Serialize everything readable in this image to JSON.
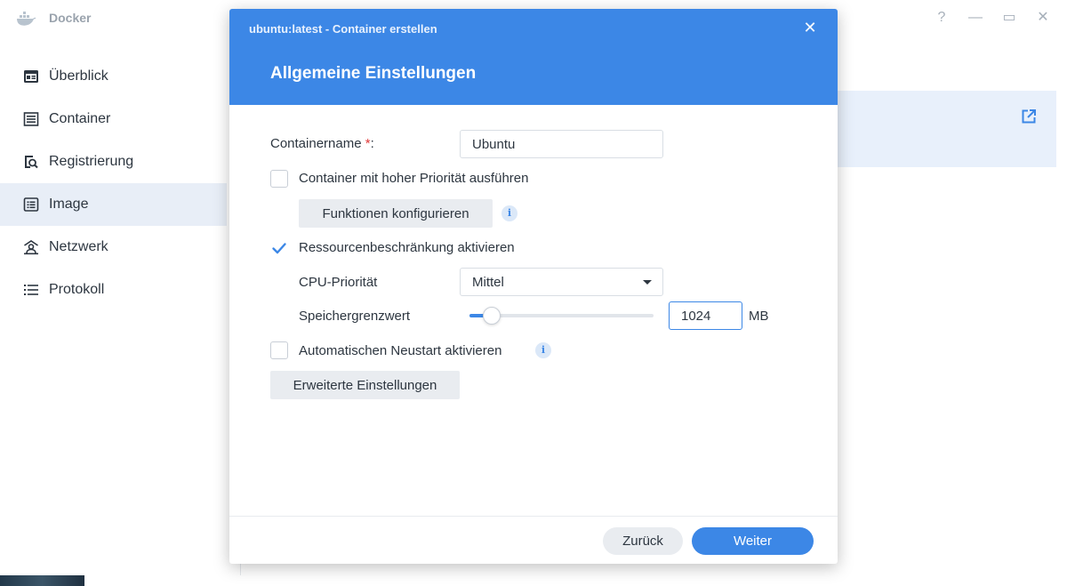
{
  "app": {
    "title": "Docker",
    "window_controls": {
      "help": "?",
      "minimize": "—",
      "maximize": "▭",
      "close": "✕"
    }
  },
  "sidebar": {
    "items": [
      {
        "label": "Überblick",
        "icon": "overview-icon"
      },
      {
        "label": "Container",
        "icon": "container-icon"
      },
      {
        "label": "Registrierung",
        "icon": "registry-search-icon"
      },
      {
        "label": "Image",
        "icon": "image-icon",
        "active": true
      },
      {
        "label": "Netzwerk",
        "icon": "network-icon"
      },
      {
        "label": "Protokoll",
        "icon": "log-list-icon"
      }
    ]
  },
  "modal": {
    "title": "ubuntu:latest - Container erstellen",
    "close": "✕",
    "heading": "Allgemeine Einstellungen",
    "container_name": {
      "label": "Containername",
      "required_mark": "*",
      "colon": ":",
      "value": "Ubuntu"
    },
    "high_priority": {
      "label": "Container mit hoher Priorität ausführen",
      "checked": false
    },
    "configure_button": "Funktionen konfigurieren",
    "info_glyph": "i",
    "resource_limit": {
      "label": "Ressourcenbeschränkung aktivieren",
      "checked": true
    },
    "cpu_priority": {
      "label": "CPU-Priorität",
      "value": "Mittel"
    },
    "memory_limit": {
      "label": "Speichergrenzwert",
      "value": "1024",
      "unit": "MB",
      "slider_fraction": 0.1
    },
    "auto_restart": {
      "label": "Automatischen Neustart aktivieren",
      "checked": false
    },
    "advanced_button": "Erweiterte Einstellungen",
    "back_button": "Zurück",
    "next_button": "Weiter"
  },
  "colors": {
    "accent": "#3c87e6",
    "required": "#e03a3a",
    "active_bg": "#e8eef7"
  }
}
